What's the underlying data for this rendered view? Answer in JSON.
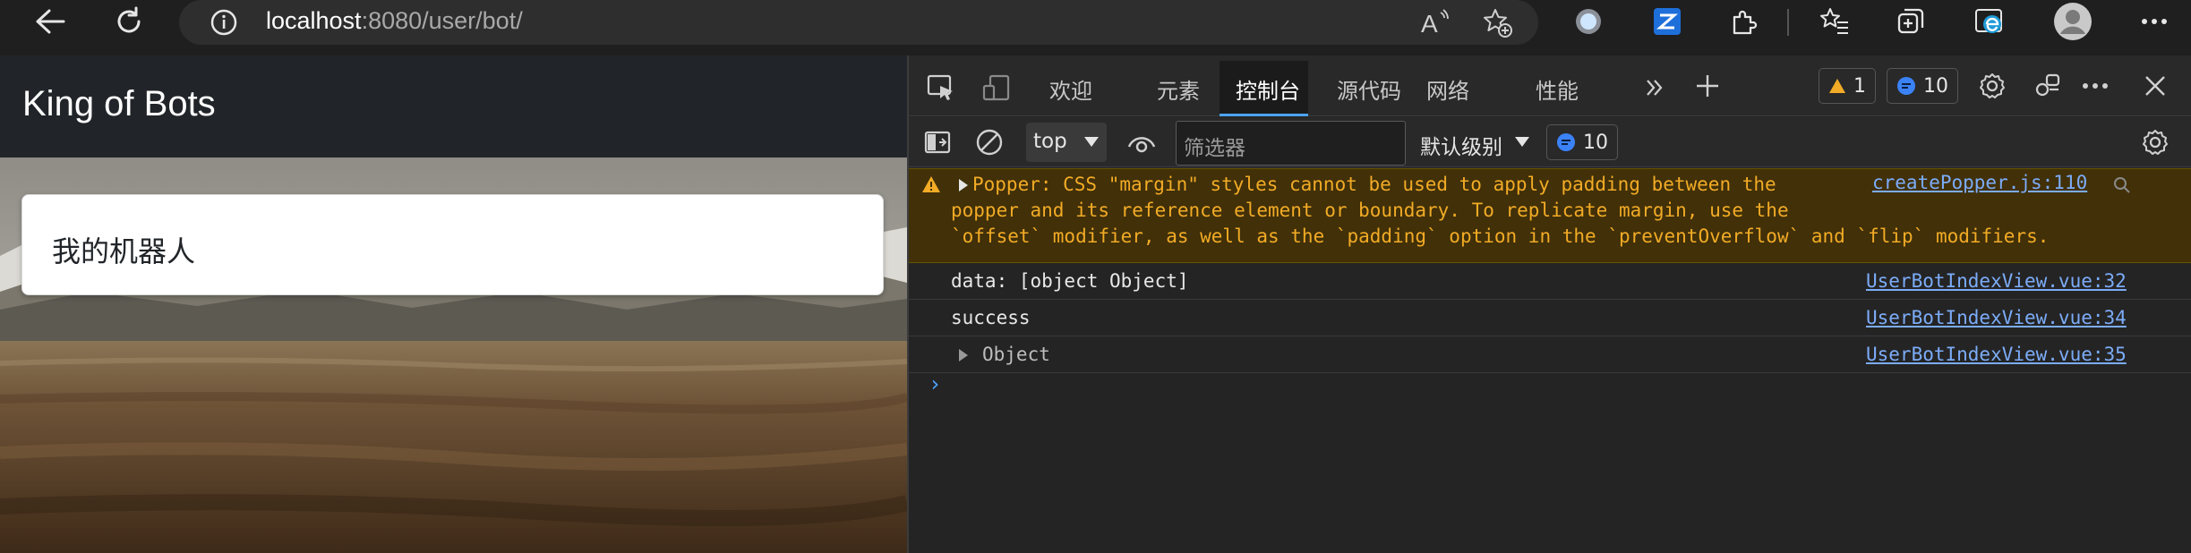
{
  "browser": {
    "url_host": "localhost",
    "url_rest": ":8080/user/bot/",
    "icons": [
      "back-arrow-icon",
      "refresh-icon",
      "info-icon",
      "read-aloud-icon",
      "add-favorite-icon",
      "extension-circle-icon",
      "extension-z-icon",
      "extensions-puzzle-icon",
      "favorites-icon",
      "collections-icon",
      "edge-icon",
      "profile-avatar-icon",
      "more-icon"
    ]
  },
  "page": {
    "brand": "King of Bots",
    "card_title": "我的机器人"
  },
  "devtools": {
    "tabs": [
      "欢迎",
      "元素",
      "控制台",
      "源代码",
      "网络",
      "性能"
    ],
    "active_tab": "控制台",
    "warnings_count": "1",
    "messages_count": "10",
    "context": "top",
    "filter_placeholder": "筛选器",
    "level": "默认级别",
    "filter_messages_count": "10",
    "colors": {
      "accent": "#4da3ff",
      "warning": "#f2ab26",
      "link": "#7cacf8"
    }
  },
  "console": {
    "warning": {
      "lines": [
        "Popper: CSS \"margin\" styles cannot be used to apply padding between the",
        "popper and its reference element or boundary. To replicate margin, use the",
        "`offset` modifier, as well as the `padding` option in the `preventOverflow` and `flip` modifiers."
      ],
      "source": "createPopper.js:110"
    },
    "logs": [
      {
        "text": "data: [object Object]",
        "source": "UserBotIndexView.vue:32"
      },
      {
        "text": "success",
        "source": "UserBotIndexView.vue:34"
      },
      {
        "text": "Object",
        "source": "UserBotIndexView.vue:35"
      }
    ],
    "prompt": "›"
  }
}
